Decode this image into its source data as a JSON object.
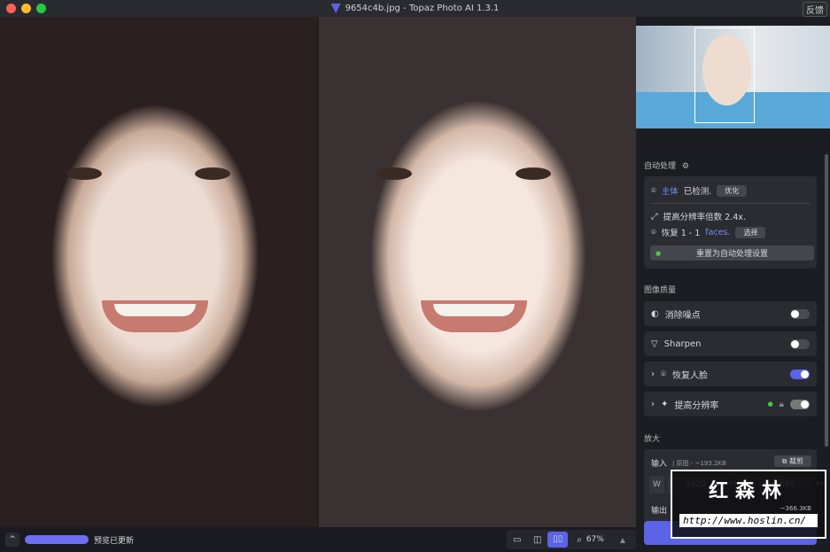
{
  "window": {
    "title": "9654c4b.jpg - Topaz Photo AI 1.3.1",
    "feedback": "反馈",
    "traffic_colors": [
      "#fe5f57",
      "#febc2e",
      "#28c840"
    ]
  },
  "auto": {
    "heading": "自动处理",
    "subject_label": "主体",
    "detected": "已检测.",
    "optimize": "优化",
    "upscale_text": "提高分辨率倍数 2.4x.",
    "restore_prefix": "恢复 1 - 1",
    "faces": "faces.",
    "select": "选择",
    "reset": "重置为自动处理设置"
  },
  "quality": {
    "heading": "图像质量",
    "items": [
      {
        "label": "消除噪点",
        "on": false
      },
      {
        "label": "Sharpen",
        "on": false
      },
      {
        "label": "恢复人脸",
        "on": true
      },
      {
        "label": "提高分辨率",
        "on": true
      }
    ]
  },
  "upscale": {
    "heading": "放大",
    "input_label": "输入",
    "input_info": "| 原图 - ~193.2KB",
    "crop": "裁剪",
    "w_label": "W",
    "width": "1920",
    "h_label": "H",
    "height": "1080",
    "unit": "PX",
    "output_label": "输出",
    "output_size": "~366.3KB"
  },
  "bottom": {
    "status": "预览已更新",
    "zoom": "67%"
  },
  "watermark": {
    "name": "红森林",
    "url": "http://www.hoslin.cn/"
  },
  "accent": "#5b63e6"
}
